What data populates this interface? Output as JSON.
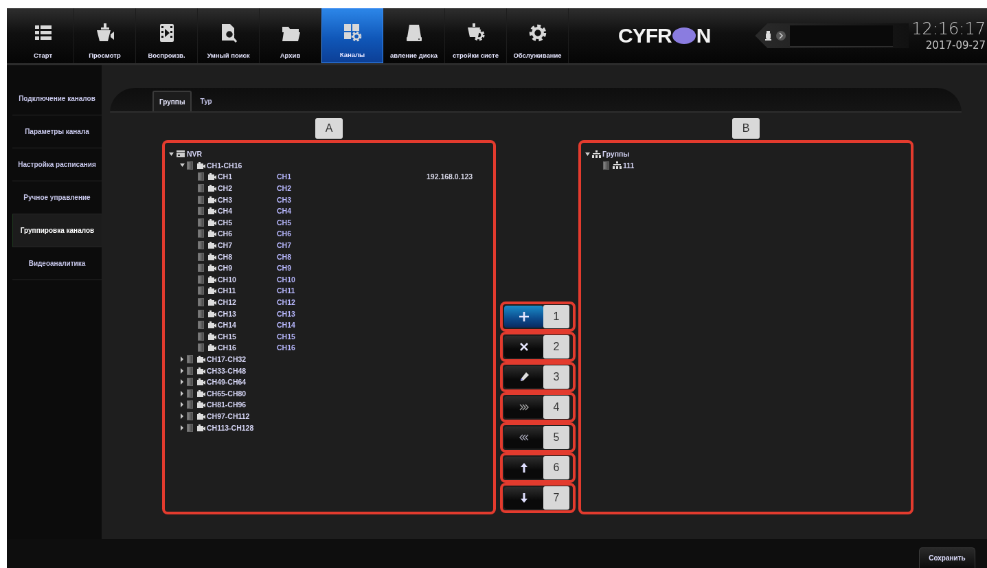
{
  "top_bar": {
    "nav": [
      {
        "label": "Старт",
        "kind": "start",
        "selected": false
      },
      {
        "label": "Просмотр",
        "kind": "live",
        "selected": false
      },
      {
        "label": "Воспроизв.",
        "kind": "playback",
        "selected": false
      },
      {
        "label": "Умный поиск",
        "kind": "search",
        "selected": false
      },
      {
        "label": "Архив",
        "kind": "archive",
        "selected": false
      },
      {
        "label": "Каналы",
        "kind": "channels",
        "selected": true
      },
      {
        "label": "авление диска",
        "kind": "disk",
        "selected": false
      },
      {
        "label": "стройки систе",
        "kind": "settings",
        "selected": false
      },
      {
        "label": "Обслуживание",
        "kind": "maintenance",
        "selected": false
      }
    ],
    "logo": {
      "left": "CYFR",
      "right": "N"
    },
    "clock": {
      "time": "12:16:17",
      "date": "2017-09-27"
    }
  },
  "sidebar": {
    "items": [
      {
        "label": "Подключение каналов",
        "selected": false
      },
      {
        "label": "Параметры канала",
        "selected": false
      },
      {
        "label": "Настройка расписания",
        "selected": false
      },
      {
        "label": "Ручное управление",
        "selected": false
      },
      {
        "label": "Группировка каналов",
        "selected": true
      },
      {
        "label": "Видеоаналитика",
        "selected": false
      }
    ]
  },
  "tabs": [
    {
      "label": "Группы",
      "selected": true
    },
    {
      "label": "Тур",
      "selected": false
    }
  ],
  "panel_a": {
    "callout": "A",
    "tree": [
      {
        "label": "NVR",
        "kind": "recorder",
        "expanded": true,
        "children": [
          {
            "label": "CH1-CH16",
            "kind": "camera",
            "checked": false,
            "expanded": true,
            "children": [
              {
                "label": "CH1",
                "kind": "camera",
                "checked": false,
                "column_2": "CH1",
                "column_3": "192.168.0.123"
              },
              {
                "label": "CH2",
                "kind": "camera",
                "checked": false,
                "column_2": "CH2"
              },
              {
                "label": "CH3",
                "kind": "camera",
                "checked": false,
                "column_2": "CH3"
              },
              {
                "label": "CH4",
                "kind": "camera",
                "checked": false,
                "column_2": "CH4"
              },
              {
                "label": "CH5",
                "kind": "camera",
                "checked": false,
                "column_2": "CH5"
              },
              {
                "label": "CH6",
                "kind": "camera",
                "checked": false,
                "column_2": "CH6"
              },
              {
                "label": "CH7",
                "kind": "camera",
                "checked": false,
                "column_2": "CH7"
              },
              {
                "label": "CH8",
                "kind": "camera",
                "checked": false,
                "column_2": "CH8"
              },
              {
                "label": "CH9",
                "kind": "camera",
                "checked": false,
                "column_2": "CH9"
              },
              {
                "label": "CH10",
                "kind": "camera",
                "checked": false,
                "column_2": "CH10"
              },
              {
                "label": "CH11",
                "kind": "camera",
                "checked": false,
                "column_2": "CH11"
              },
              {
                "label": "CH12",
                "kind": "camera",
                "checked": false,
                "column_2": "CH12"
              },
              {
                "label": "CH13",
                "kind": "camera",
                "checked": false,
                "column_2": "CH13"
              },
              {
                "label": "CH14",
                "kind": "camera",
                "checked": false,
                "column_2": "CH14"
              },
              {
                "label": "CH15",
                "kind": "camera",
                "checked": false,
                "column_2": "CH15"
              },
              {
                "label": "CH16",
                "kind": "camera",
                "checked": false,
                "column_2": "CH16"
              }
            ]
          },
          {
            "label": "CH17-CH32",
            "kind": "camera",
            "checked": false,
            "expanded": false
          },
          {
            "label": "CH33-CH48",
            "kind": "camera",
            "checked": false,
            "expanded": false
          },
          {
            "label": "CH49-CH64",
            "kind": "camera",
            "checked": false,
            "expanded": false
          },
          {
            "label": "CH65-CH80",
            "kind": "camera",
            "checked": false,
            "expanded": false
          },
          {
            "label": "CH81-CH96",
            "kind": "camera",
            "checked": false,
            "expanded": false
          },
          {
            "label": "CH97-CH112",
            "kind": "camera",
            "checked": false,
            "expanded": false
          },
          {
            "label": "CH113-CH128",
            "kind": "camera",
            "checked": false,
            "expanded": false
          }
        ]
      }
    ]
  },
  "actions": [
    {
      "kind": "add",
      "callout": "1",
      "selected": true
    },
    {
      "kind": "delete",
      "callout": "2",
      "selected": false
    },
    {
      "kind": "edit",
      "callout": "3",
      "selected": false
    },
    {
      "kind": "move_right",
      "callout": "4",
      "selected": false
    },
    {
      "kind": "move_left",
      "callout": "5",
      "selected": false
    },
    {
      "kind": "up",
      "callout": "6",
      "selected": false
    },
    {
      "kind": "down",
      "callout": "7",
      "selected": false
    }
  ],
  "panel_b": {
    "callout": "B",
    "tree": [
      {
        "label": "Группы",
        "kind": "group",
        "expanded": true,
        "children": [
          {
            "label": "111",
            "kind": "group",
            "checked": false
          }
        ]
      }
    ]
  },
  "save_button": "Сохранить"
}
